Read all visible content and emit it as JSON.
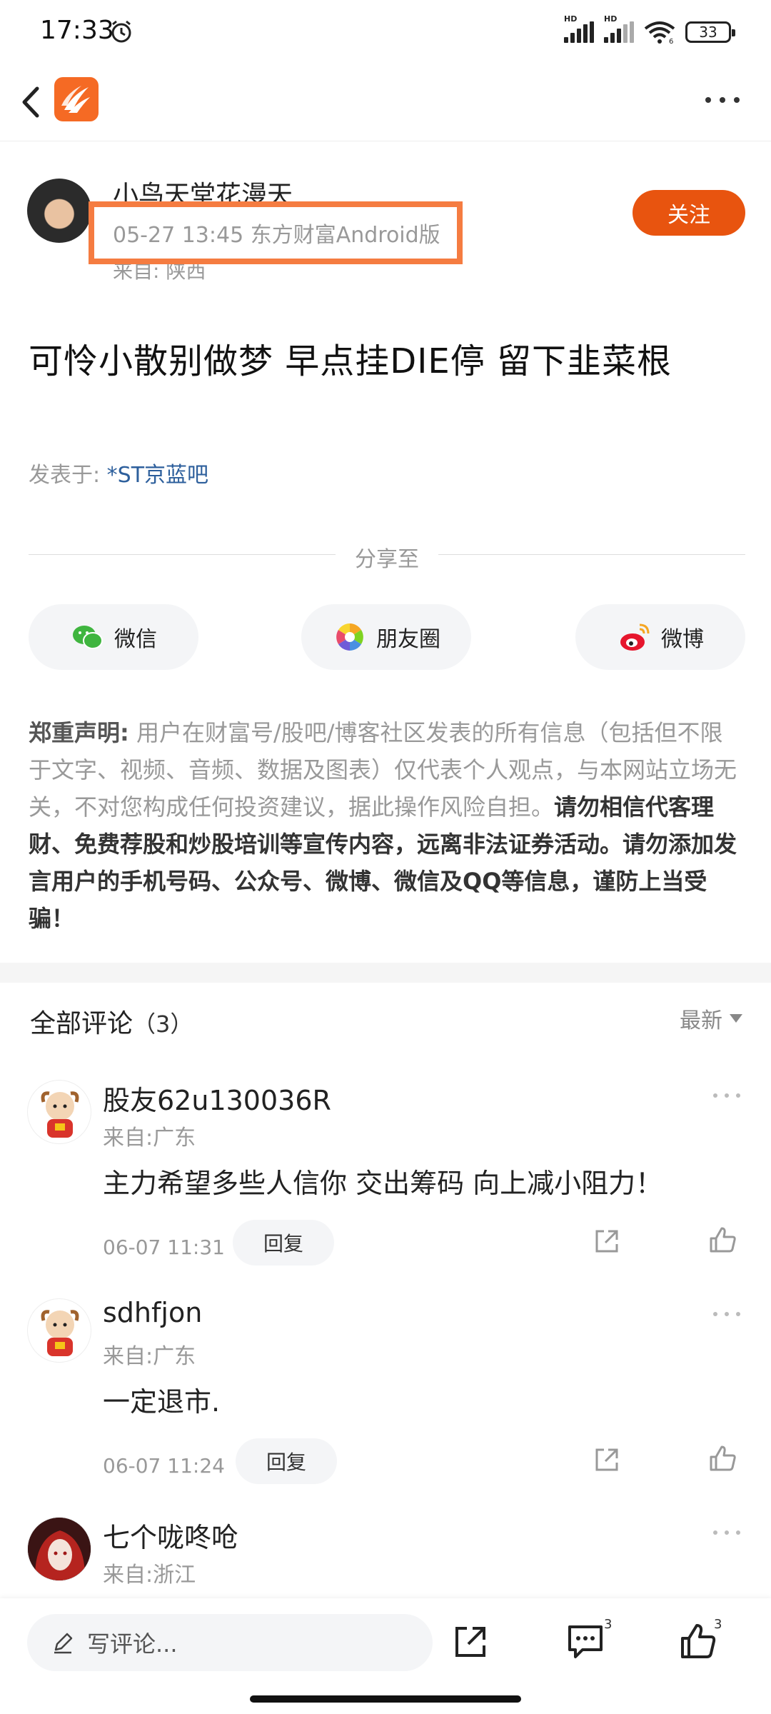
{
  "status_bar": {
    "time": "17:33",
    "network_1": "HD",
    "network_2": "HD",
    "wifi_badge": "6",
    "battery": "33"
  },
  "nav": {
    "back_icon": "chevron-left-icon",
    "logo_icon": "eastmoney-logo",
    "more_icon": "more-horizontal-icon"
  },
  "post": {
    "author_name": "小鸟天堂花漫天",
    "meta": "05-27 13:45 东方财富Android版",
    "from": "来自: 陕西",
    "follow_label": "关注",
    "title": "可怜小散别做梦 早点挂DIE停 留下韭菜根",
    "posted_in_label": "发表于: ",
    "posted_in_bar": "*ST京蓝吧"
  },
  "share": {
    "label": "分享至",
    "buttons": [
      {
        "label": "微信",
        "icon": "wechat-icon"
      },
      {
        "label": "朋友圈",
        "icon": "moments-icon"
      },
      {
        "label": "微博",
        "icon": "weibo-icon"
      }
    ]
  },
  "disclaimer": {
    "lead": "郑重声明:",
    "body": " 用户在财富号/股吧/博客社区发表的所有信息（包括但不限于文字、视频、音频、数据及图表）仅代表个人观点，与本网站立场无关，不对您构成任何投资建议，据此操作风险自担。",
    "strong": "请勿相信代客理财、免费荐股和炒股培训等宣传内容，远离非法证券活动。请勿添加发言用户的手机号码、公众号、微博、微信及QQ等信息，谨防上当受骗！"
  },
  "comments_section": {
    "title": "全部评论",
    "count": "（3）",
    "sort_label": "最新"
  },
  "comments": [
    {
      "name": "股友62u130036R",
      "from": "来自:广东",
      "text": "主力希望多些人信你  交出筹码  向上减小阻力！",
      "time": "06-07 11:31",
      "reply_label": "回复"
    },
    {
      "name": "sdhfjon",
      "from": "来自:广东",
      "text": "一定退市.",
      "time": "06-07 11:24",
      "reply_label": "回复"
    },
    {
      "name": "七个咙咚呛",
      "from": "来自:浙江"
    }
  ],
  "bottom_bar": {
    "input_placeholder": "写评论...",
    "comment_count": "3",
    "like_count": "3"
  }
}
